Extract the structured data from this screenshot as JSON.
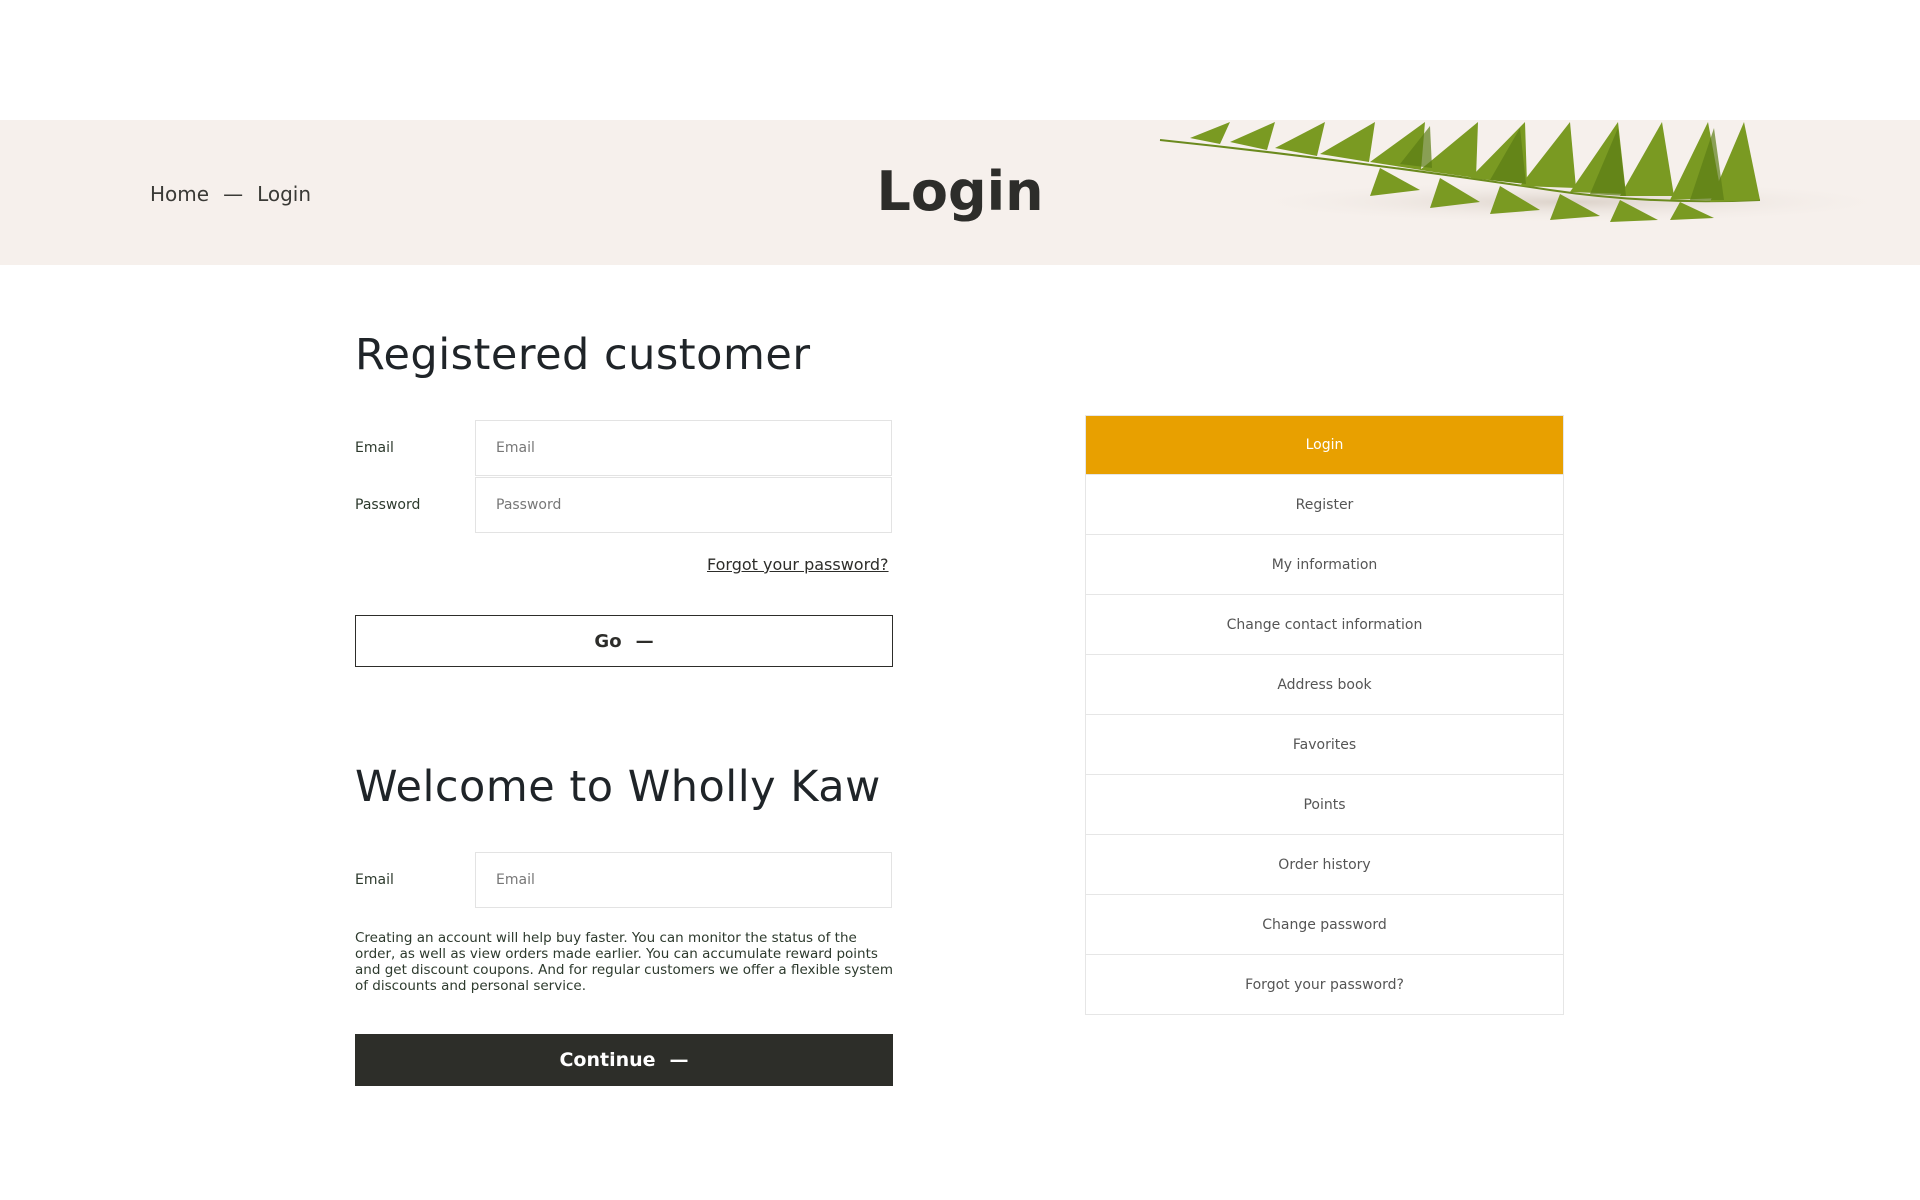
{
  "breadcrumb": {
    "home": "Home",
    "separator": "—",
    "current": "Login"
  },
  "page_title": "Login",
  "login_section": {
    "title": "Registered customer",
    "email_label": "Email",
    "email_placeholder": "Email",
    "password_label": "Password",
    "password_placeholder": "Password",
    "forgot_link": "Forgot your password?",
    "go_label": "Go",
    "go_icon": "—"
  },
  "register_section": {
    "title": "Welcome to Wholly Kaw",
    "email_label": "Email",
    "email_placeholder": "Email",
    "description": "Creating an account will help buy faster. You can monitor the status of the order, as well as view orders made earlier. You can accumulate reward points and get discount coupons. And for regular customers we offer a flexible system of discounts and personal service.",
    "continue_label": "Continue",
    "continue_icon": "—"
  },
  "account_menu": {
    "items": [
      {
        "label": "Login",
        "active": true
      },
      {
        "label": "Register"
      },
      {
        "label": "My information"
      },
      {
        "label": "Change contact information"
      },
      {
        "label": "Address book"
      },
      {
        "label": "Favorites"
      },
      {
        "label": "Points"
      },
      {
        "label": "Order history"
      },
      {
        "label": "Change password"
      },
      {
        "label": "Forgot your password?"
      }
    ]
  },
  "colors": {
    "accent": "#e8a000",
    "banner_bg": "#f6f0ec",
    "dark_button": "#2d2e29"
  }
}
